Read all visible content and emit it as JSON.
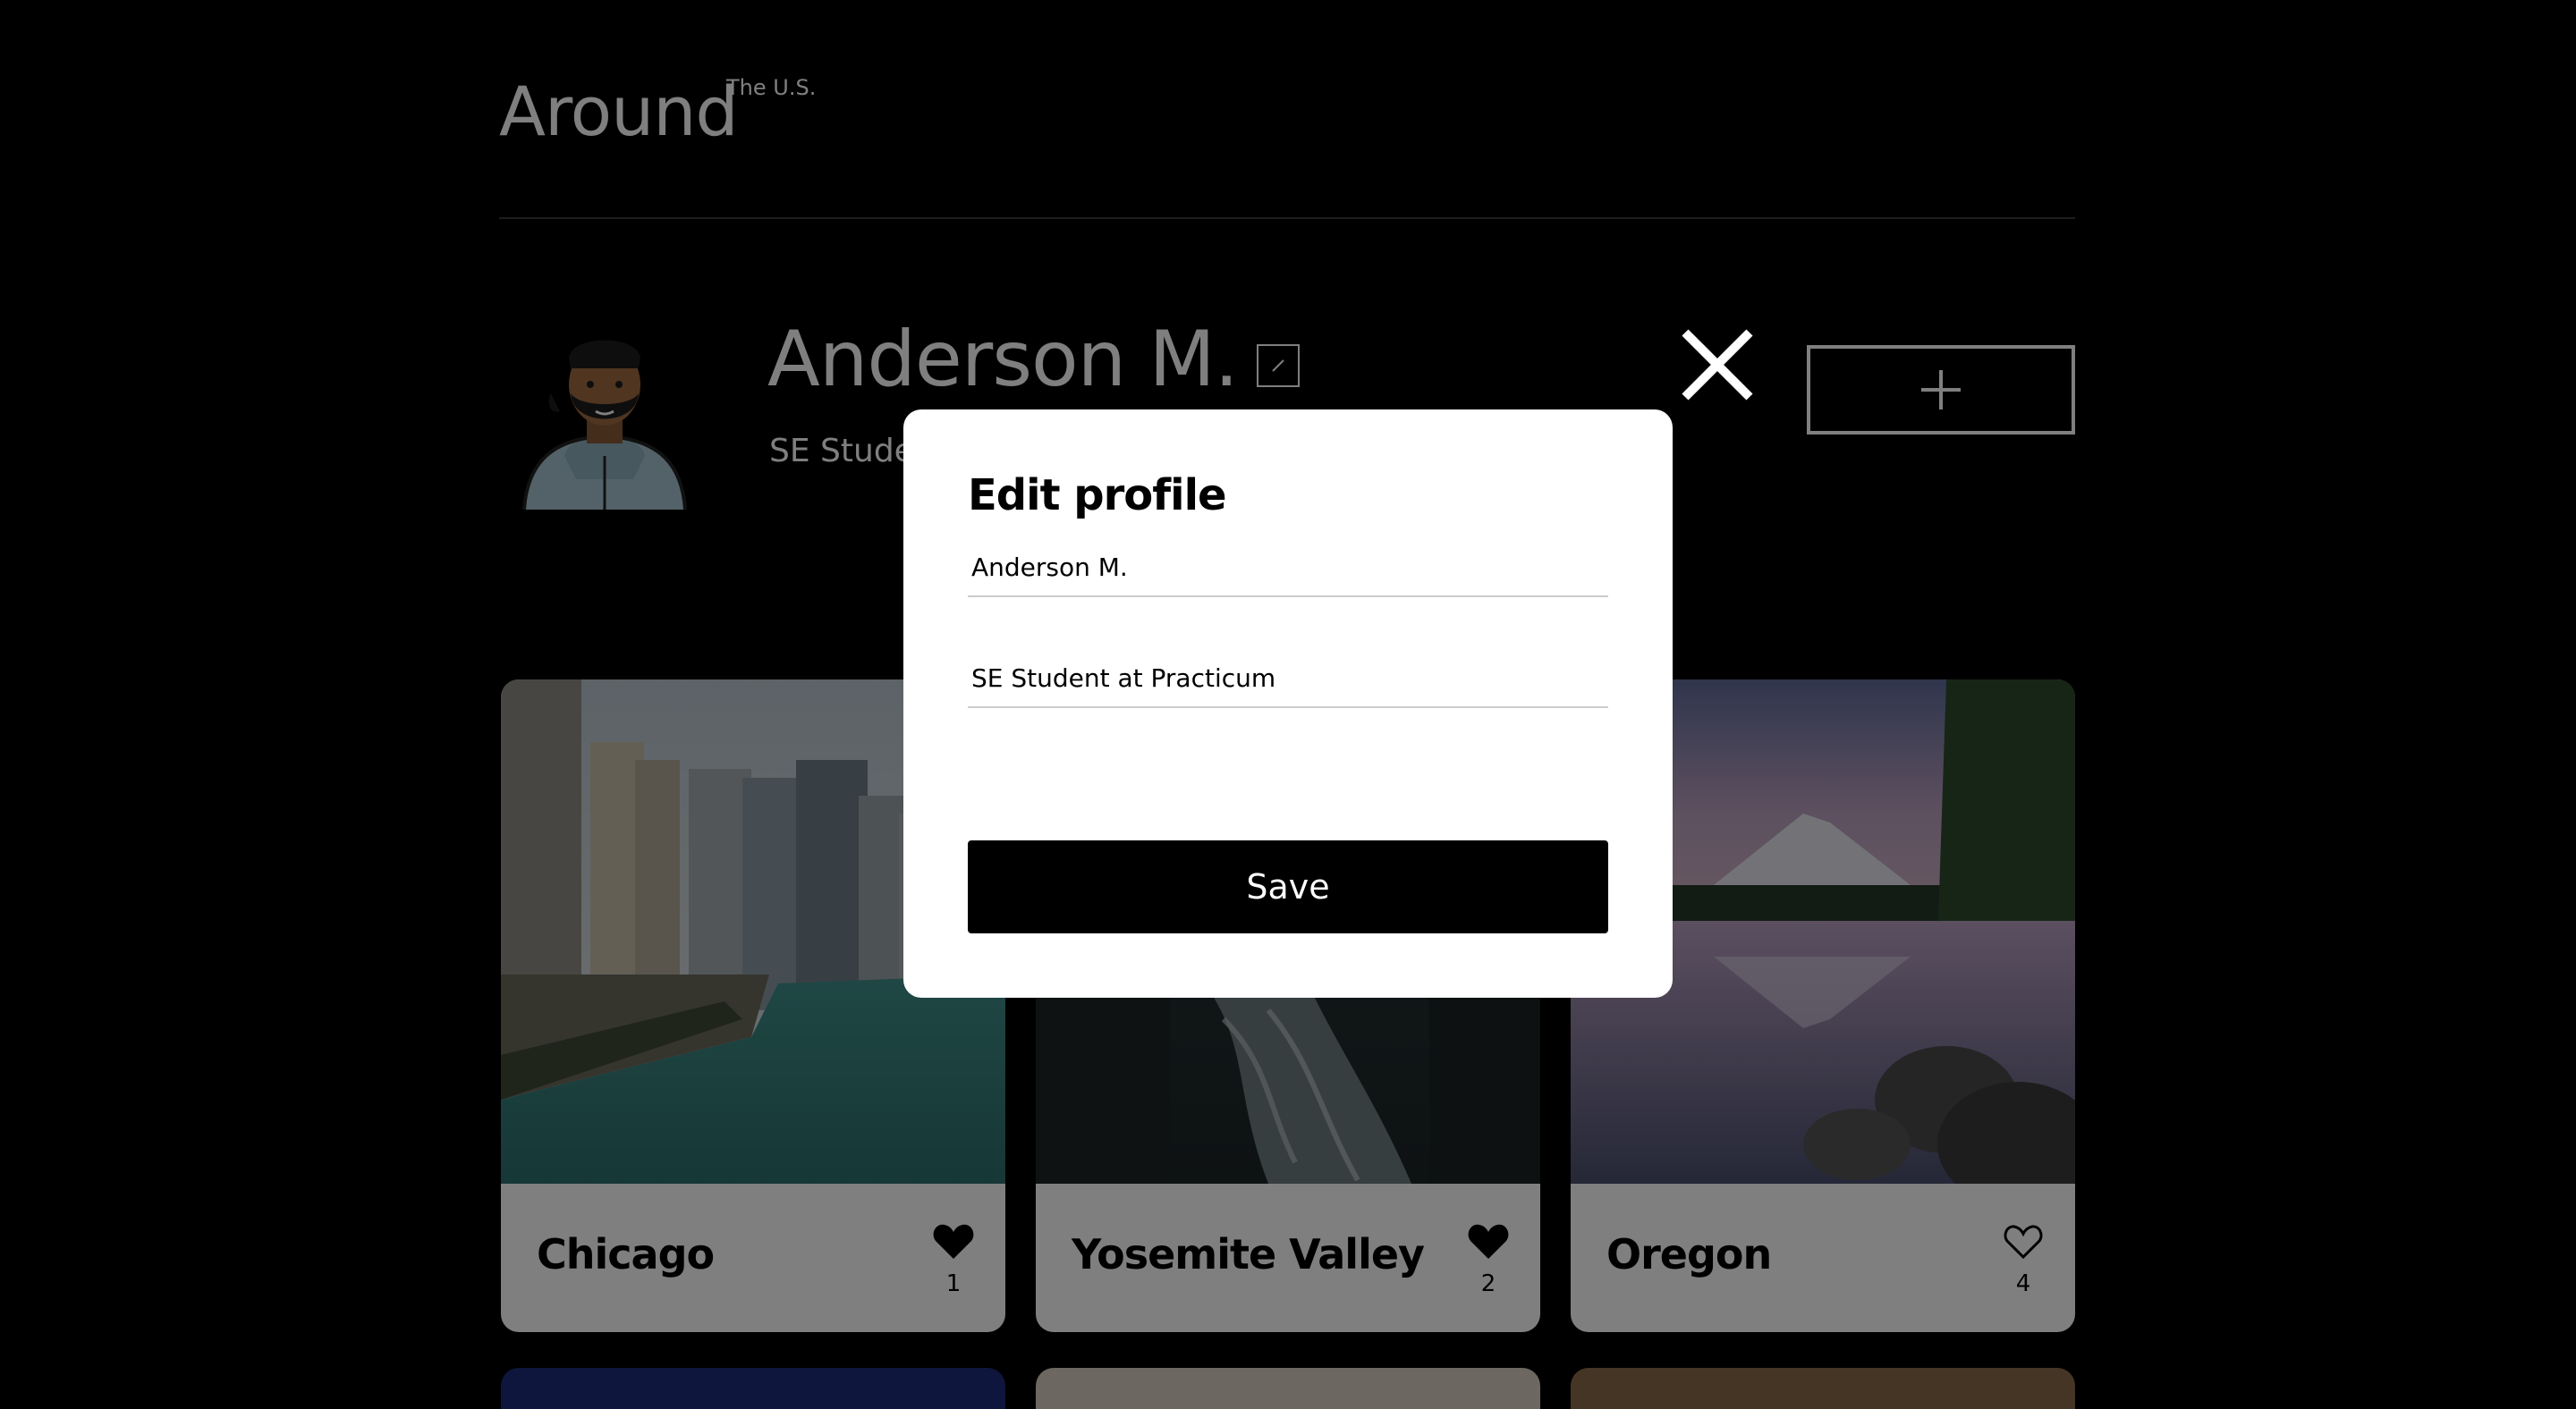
{
  "header": {
    "logo_main": "Around",
    "logo_sup": "The U.S."
  },
  "profile": {
    "name": "Anderson M.",
    "about": "SE Student at Practicum",
    "avatar_icon": "avatar-illustration",
    "edit_icon": "pencil-icon",
    "add_icon": "plus-icon"
  },
  "cards": [
    {
      "title": "Chicago",
      "likes": "1",
      "liked": true
    },
    {
      "title": "Yosemite Valley",
      "likes": "2",
      "liked": true
    },
    {
      "title": "Oregon",
      "likes": "4",
      "liked": false
    }
  ],
  "modal": {
    "title": "Edit profile",
    "name_value": "Anderson M.",
    "about_value": "SE Student at Practicum",
    "save_label": "Save",
    "close_icon": "close-icon"
  },
  "colors": {
    "background": "#000000",
    "modal_bg": "#ffffff",
    "overlay": "rgba(0,0,0,0.5)"
  }
}
